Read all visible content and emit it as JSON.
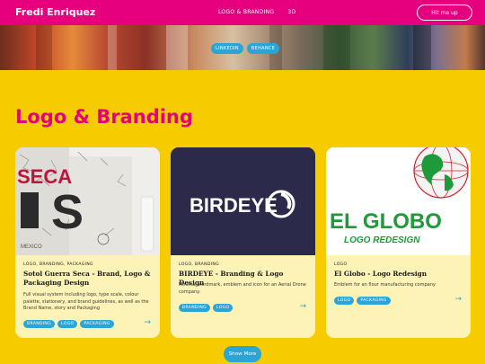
{
  "nav": {
    "brand": "Fredi Enriquez",
    "links": [
      "LOGO & BRANDING",
      "3D"
    ],
    "cta": "Hit me up"
  },
  "hero": {
    "pills": [
      "LINKEDIN",
      "BEHANCE"
    ]
  },
  "section": {
    "title": "Logo & Branding"
  },
  "cards": [
    {
      "image_text": [
        "SECA",
        "S",
        "MEXICO"
      ],
      "category": "LOGO, BRANDING, PACKAGING",
      "title": "Sotol Guerra Seca - Brand, Logo & Packaging Design",
      "description": "Full visual system including logo, type scale, colour palette, stationery, and brand guidelines, as well as the Brand Name, story and Packaging",
      "chips": [
        "BRANDING",
        "LOGO",
        "PACKAGING"
      ]
    },
    {
      "image_text": [
        "BIRDEYE"
      ],
      "category": "LOGO, BRANDING",
      "title": "BIRDEYE - Branding & Logo Design",
      "description": "Minimal wordmark, emblem and icon for an Aerial Drone company.",
      "chips": [
        "BRANDING",
        "LOGO"
      ]
    },
    {
      "image_text": [
        "EL GLOBO",
        "LOGO REDESIGN"
      ],
      "category": "LOGO",
      "title": "El Globo - Logo Redesign",
      "description": "Emblem for an flour manufacturing company",
      "chips": [
        "LOGO",
        "PACKAGING"
      ]
    }
  ],
  "show_more": "Show More",
  "colors": {
    "nav_bg": "#e6007e",
    "page_bg": "#f6cb00",
    "accent": "#2aa5d8",
    "card_bg": "#fdf3b7",
    "globo_green": "#1f9a3a",
    "globo_red": "#d4202a",
    "birdeye_bg": "#2c2a4a"
  }
}
